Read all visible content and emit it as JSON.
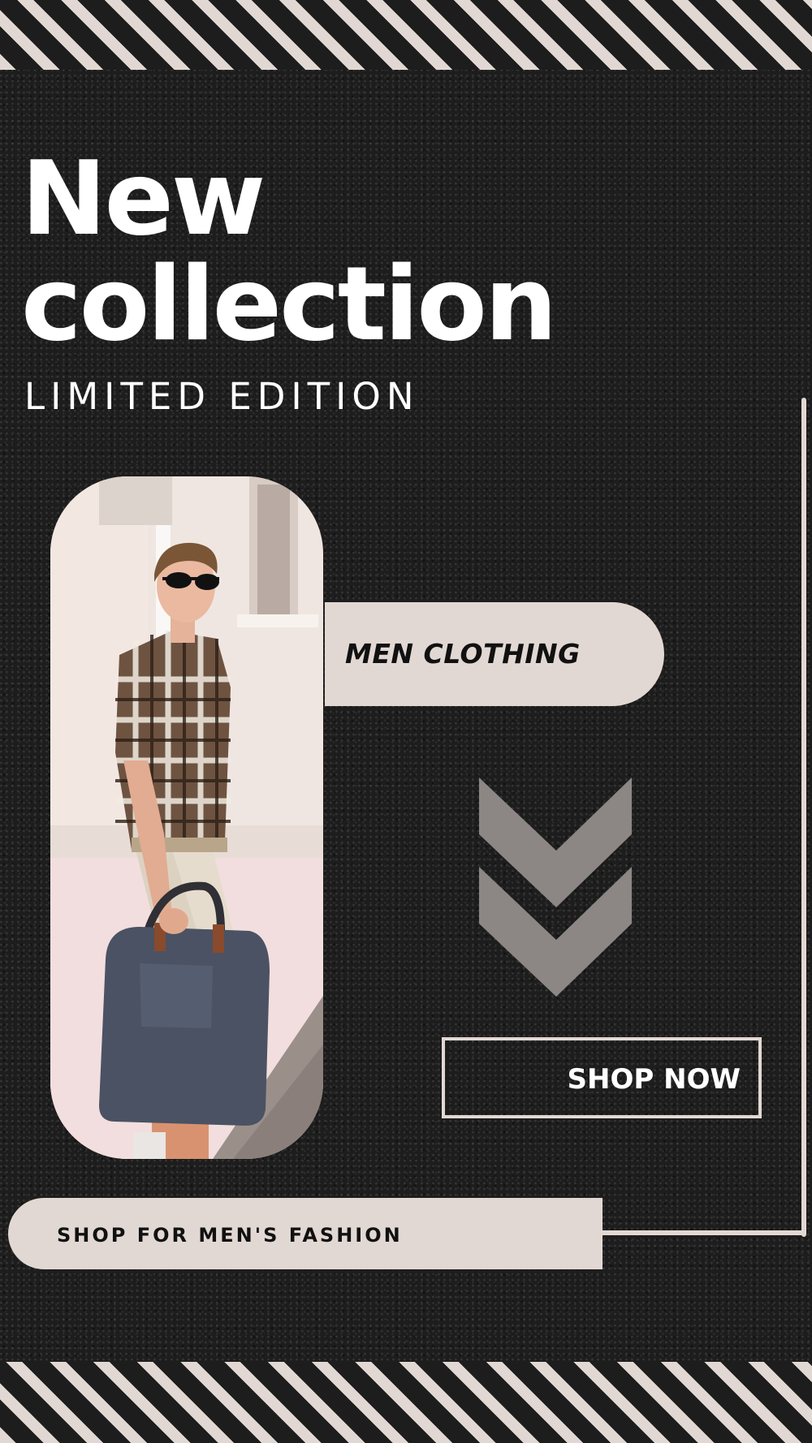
{
  "headline": {
    "line1": "New",
    "line2": "collection",
    "subtitle": "LIMITED EDITION"
  },
  "category": {
    "label": "MEN CLOTHING"
  },
  "cta": {
    "label": "SHOP NOW"
  },
  "tagline": {
    "label": "SHOP FOR MEN'S FASHION"
  },
  "colors": {
    "background": "#1d1d1d",
    "accent_beige": "#e2d8d3",
    "text_light": "#ffffff",
    "text_dark": "#111111",
    "chevron": "#8c8784"
  },
  "icons": [
    "double-chevron-down-icon"
  ]
}
